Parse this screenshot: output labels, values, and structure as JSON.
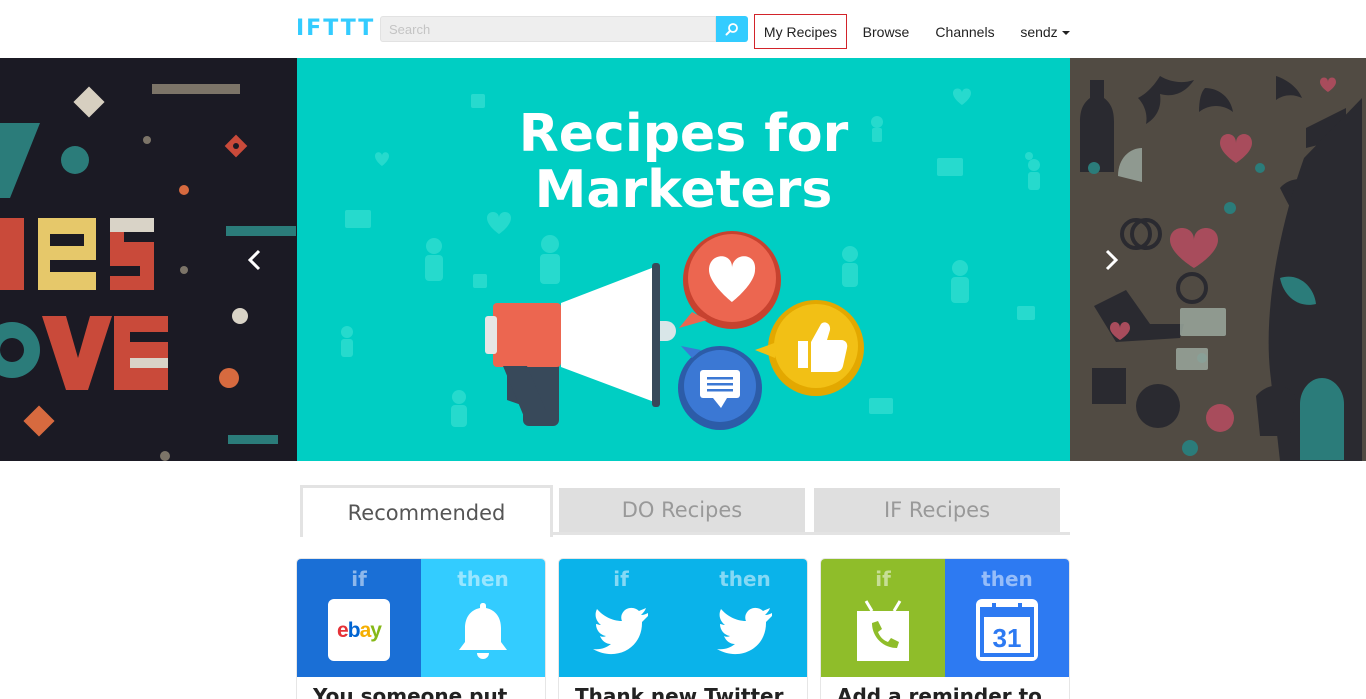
{
  "header": {
    "logo": "IFTTT",
    "search_placeholder": "Search",
    "nav": {
      "my_recipes": "My Recipes",
      "browse": "Browse",
      "channels": "Channels",
      "user": "sendz"
    }
  },
  "carousel": {
    "title_line1": "Recipes for",
    "title_line2": "Marketers",
    "accent": "#00cec3"
  },
  "tabs": [
    {
      "label": "Recommended",
      "active": true
    },
    {
      "label": "DO Recipes",
      "active": false
    },
    {
      "label": "IF Recipes",
      "active": false
    }
  ],
  "cards": [
    {
      "if_label": "if",
      "then_label": "then",
      "if_icon": "ebay-icon",
      "then_icon": "notification-bell-icon",
      "if_color": "#1a6fd6",
      "then_color": "#33ccff",
      "desc": "You someone put..."
    },
    {
      "if_label": "if",
      "then_label": "then",
      "if_icon": "twitter-icon",
      "then_icon": "twitter-icon",
      "if_color": "#0ab3ea",
      "then_color": "#0ab3ea",
      "desc": "Thank new Twitter..."
    },
    {
      "if_label": "if",
      "then_label": "then",
      "if_icon": "android-phone-icon",
      "then_icon": "google-calendar-icon",
      "if_color": "#8fbd2a",
      "then_color": "#2d7af2",
      "desc": "Add a reminder to..."
    }
  ]
}
